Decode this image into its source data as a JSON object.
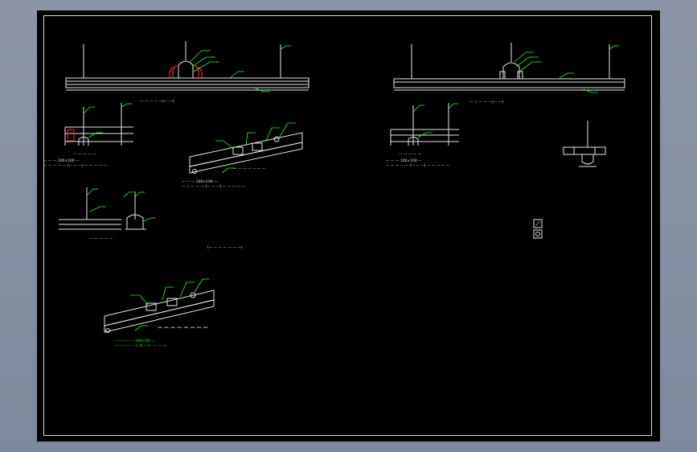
{
  "viewer": {
    "background_color": "#8a96a8",
    "sheet_color": "#000000",
    "line_color": "#e6e6e6",
    "annotation_color": "#25ff25",
    "highlight_color": "#ff2020"
  },
  "labels": {
    "left_top_caption": "— — — — —(— —)",
    "left_mid_caption": "— — — — —",
    "left_mid_spec_1": "— — — 100×100 —",
    "left_mid_spec_2": "— — — — — (— — —) — — — — —",
    "iso_caption": "— — — — — — —",
    "iso_spec_1": "— — — 100×100 —",
    "iso_spec_2": "— — — — — (— — —) — — — — —",
    "small_detail_caption": "— — — — —",
    "center_note": "(— — — — — — —)",
    "bottom_iso_caption": "— — — — — — — —",
    "bottom_iso_spec_1": "— — — — — 100×100 —",
    "bottom_iso_spec_2": "— — — — — 1.10 — (— — — —)",
    "right_top_caption": "— — — — —(— —)",
    "right_mid_caption": "— — — — —",
    "right_mid_spec_1": "— — — 100×100 —",
    "right_mid_spec_2": "— — — — — (— — —) — — — — —"
  }
}
